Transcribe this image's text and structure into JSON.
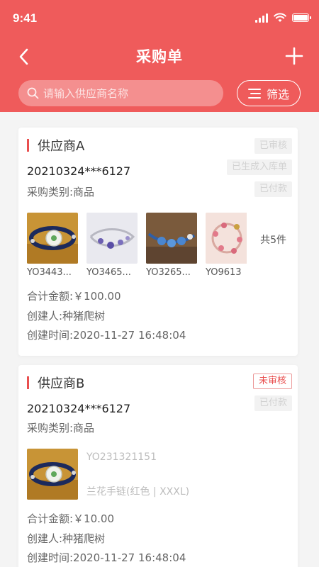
{
  "status_bar": {
    "time": "9:41"
  },
  "nav": {
    "title": "采购单"
  },
  "search": {
    "placeholder": "请输入供应商名称"
  },
  "filter": {
    "label": "筛选"
  },
  "colors": {
    "brand": "#ef5b5b",
    "accent_red": "#e94f4f",
    "muted_badge": "#d2d2d2"
  },
  "orders": [
    {
      "supplier": "供应商A",
      "badges": [
        "已审核",
        "已生成入库单",
        "已付款"
      ],
      "order_no": "20210324***6127",
      "category": "采购类别:商品",
      "items": [
        {
          "code": "YO3443..."
        },
        {
          "code": "YO3465..."
        },
        {
          "code": "YO3265..."
        },
        {
          "code": "YO9613"
        }
      ],
      "item_count": "共5件",
      "total": "合计金额:￥100.00",
      "creator": "创建人:种猪爬树",
      "created_at": "创建时间:2020-11-27 16:48:04"
    },
    {
      "supplier": "供应商B",
      "badges": [
        "未审核",
        "已付款"
      ],
      "order_no": "20210324***6127",
      "category": "采购类别:商品",
      "product": {
        "code": "YO231321151",
        "name": "兰花手链(红色 | XXXL)"
      },
      "total": "合计金额:￥10.00",
      "creator": "创建人:种猪爬树",
      "created_at": "创建时间:2020-11-27 16:48:04"
    }
  ]
}
